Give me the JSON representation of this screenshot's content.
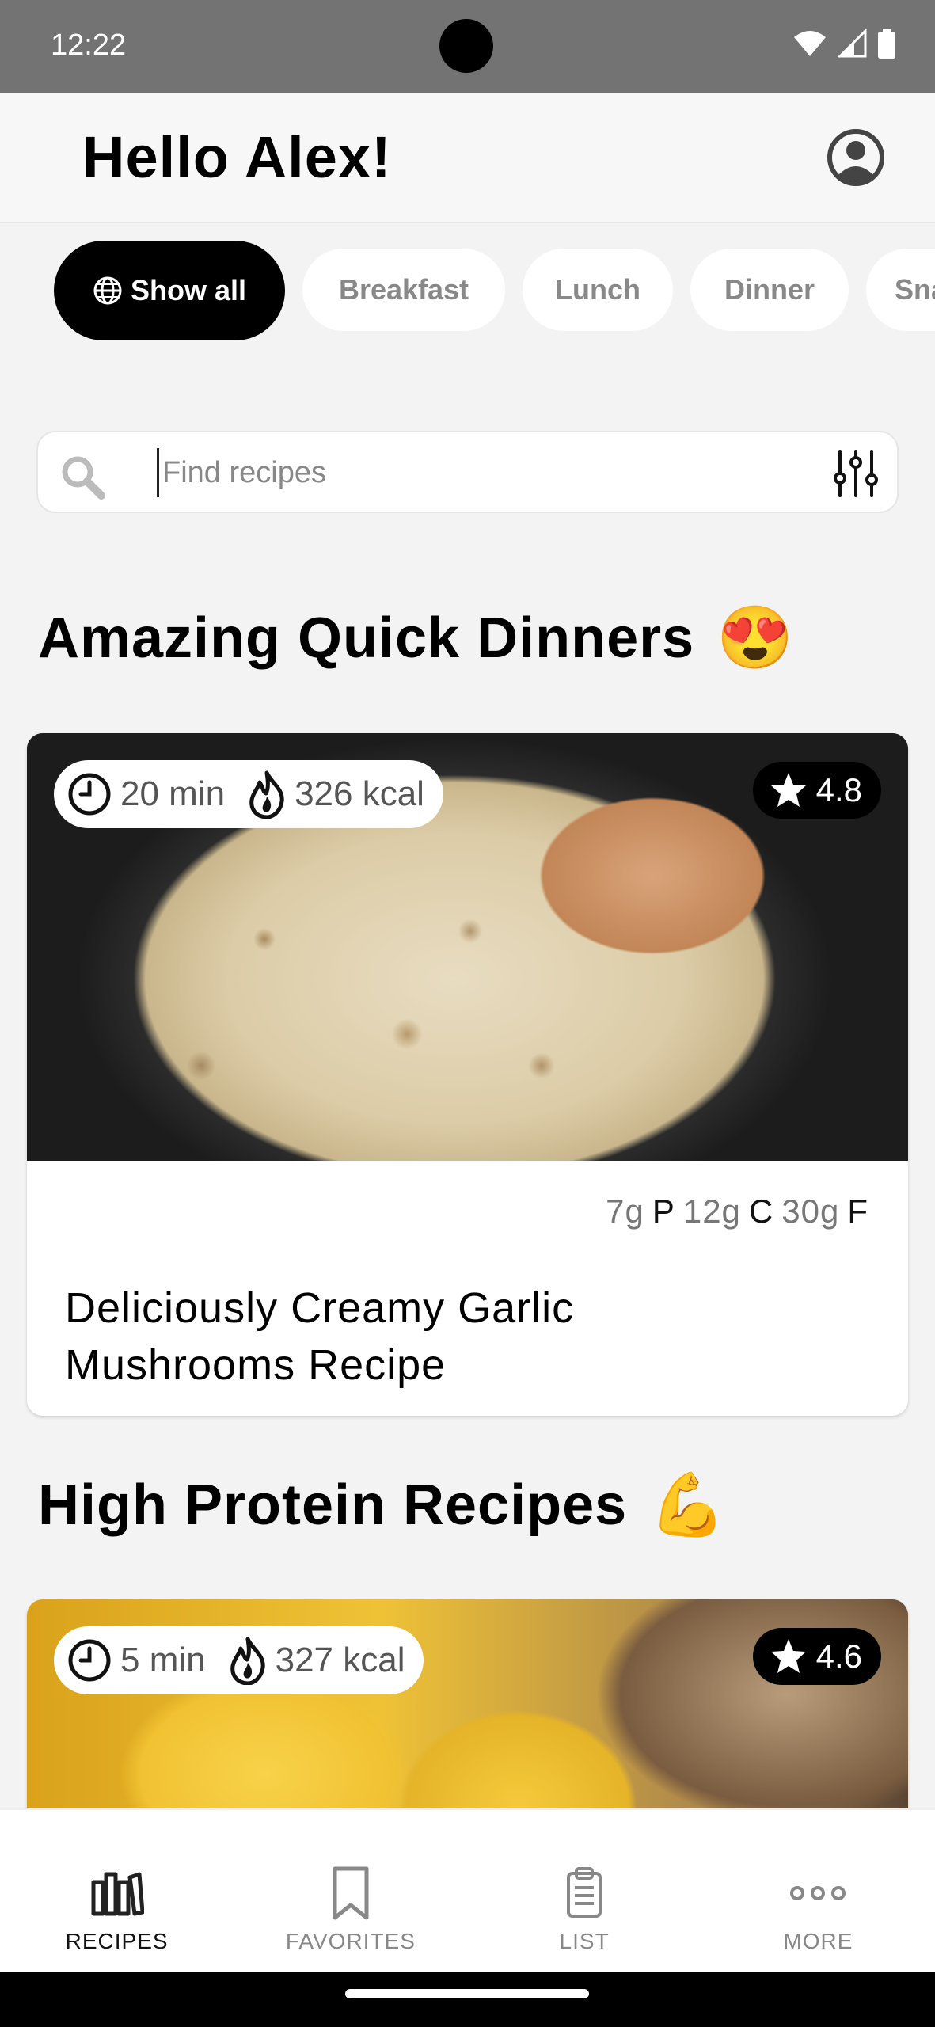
{
  "status_bar": {
    "time": "12:22"
  },
  "header": {
    "greeting": "Hello Alex!"
  },
  "chips": [
    {
      "label": "Show all"
    },
    {
      "label": "Breakfast"
    },
    {
      "label": "Lunch"
    },
    {
      "label": "Dinner"
    },
    {
      "label": "Sna"
    }
  ],
  "search": {
    "placeholder": "Find recipes"
  },
  "sections": [
    {
      "title": "Amazing Quick Dinners",
      "emoji": "😍",
      "recipe": {
        "time": "20 min",
        "kcal": "326 kcal",
        "rating": "4.8",
        "protein": "7g",
        "protein_unit": "P",
        "carbs": "12g",
        "carbs_unit": "C",
        "fat": "30g",
        "fat_unit": "F",
        "title": "Deliciously Creamy Garlic Mushrooms Recipe"
      }
    },
    {
      "title": "High Protein Recipes",
      "emoji": "💪",
      "recipe": {
        "time": "5 min",
        "kcal": "327 kcal",
        "rating": "4.6"
      }
    }
  ],
  "bottom_nav": [
    {
      "label": "RECIPES",
      "icon": "books-icon"
    },
    {
      "label": "FAVORITES",
      "icon": "bookmark-icon"
    },
    {
      "label": "LIST",
      "icon": "clipboard-icon"
    },
    {
      "label": "MORE",
      "icon": "more-dots-icon"
    }
  ],
  "colors": {
    "accent": "#000000",
    "background": "#f3f3f3",
    "chip_inactive_text": "#888888"
  }
}
